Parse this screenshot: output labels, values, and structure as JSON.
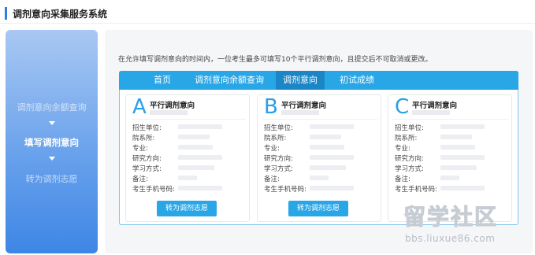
{
  "header": {
    "title": "调剂意向采集服务系统"
  },
  "sidebar": {
    "items": [
      {
        "label": "调剂意向余额查询",
        "state": "dim"
      },
      {
        "label": "填写调剂意向",
        "state": "active"
      },
      {
        "label": "转为调剂志愿",
        "state": "dim"
      }
    ]
  },
  "notice": "在允许填写调剂意向的时间内，一位考生最多可填写10个平行调剂意向，且提交后不可取消或更改。",
  "tabs": [
    {
      "label": "首页",
      "active": false
    },
    {
      "label": "调剂意向余额查询",
      "active": false
    },
    {
      "label": "调剂意向",
      "active": true
    },
    {
      "label": "初试成绩",
      "active": false
    }
  ],
  "columns": [
    {
      "letter": "A",
      "title": "平行调剂意向"
    },
    {
      "letter": "B",
      "title": "平行调剂意向"
    },
    {
      "letter": "C",
      "title": "平行调剂意向"
    }
  ],
  "fields": [
    "招生单位:",
    "院系所:",
    "专业:",
    "研究方向:",
    "学习方式:",
    "备注:",
    "考生手机号码:"
  ],
  "convert_label": "转为调剂志愿",
  "watermark": {
    "main": "留学社区",
    "url": "bbs.liuxue86.com"
  },
  "colors": {
    "accent": "#29a6e6",
    "tab_active": "#1b86c6",
    "header_bar": "#2f7fe0"
  }
}
